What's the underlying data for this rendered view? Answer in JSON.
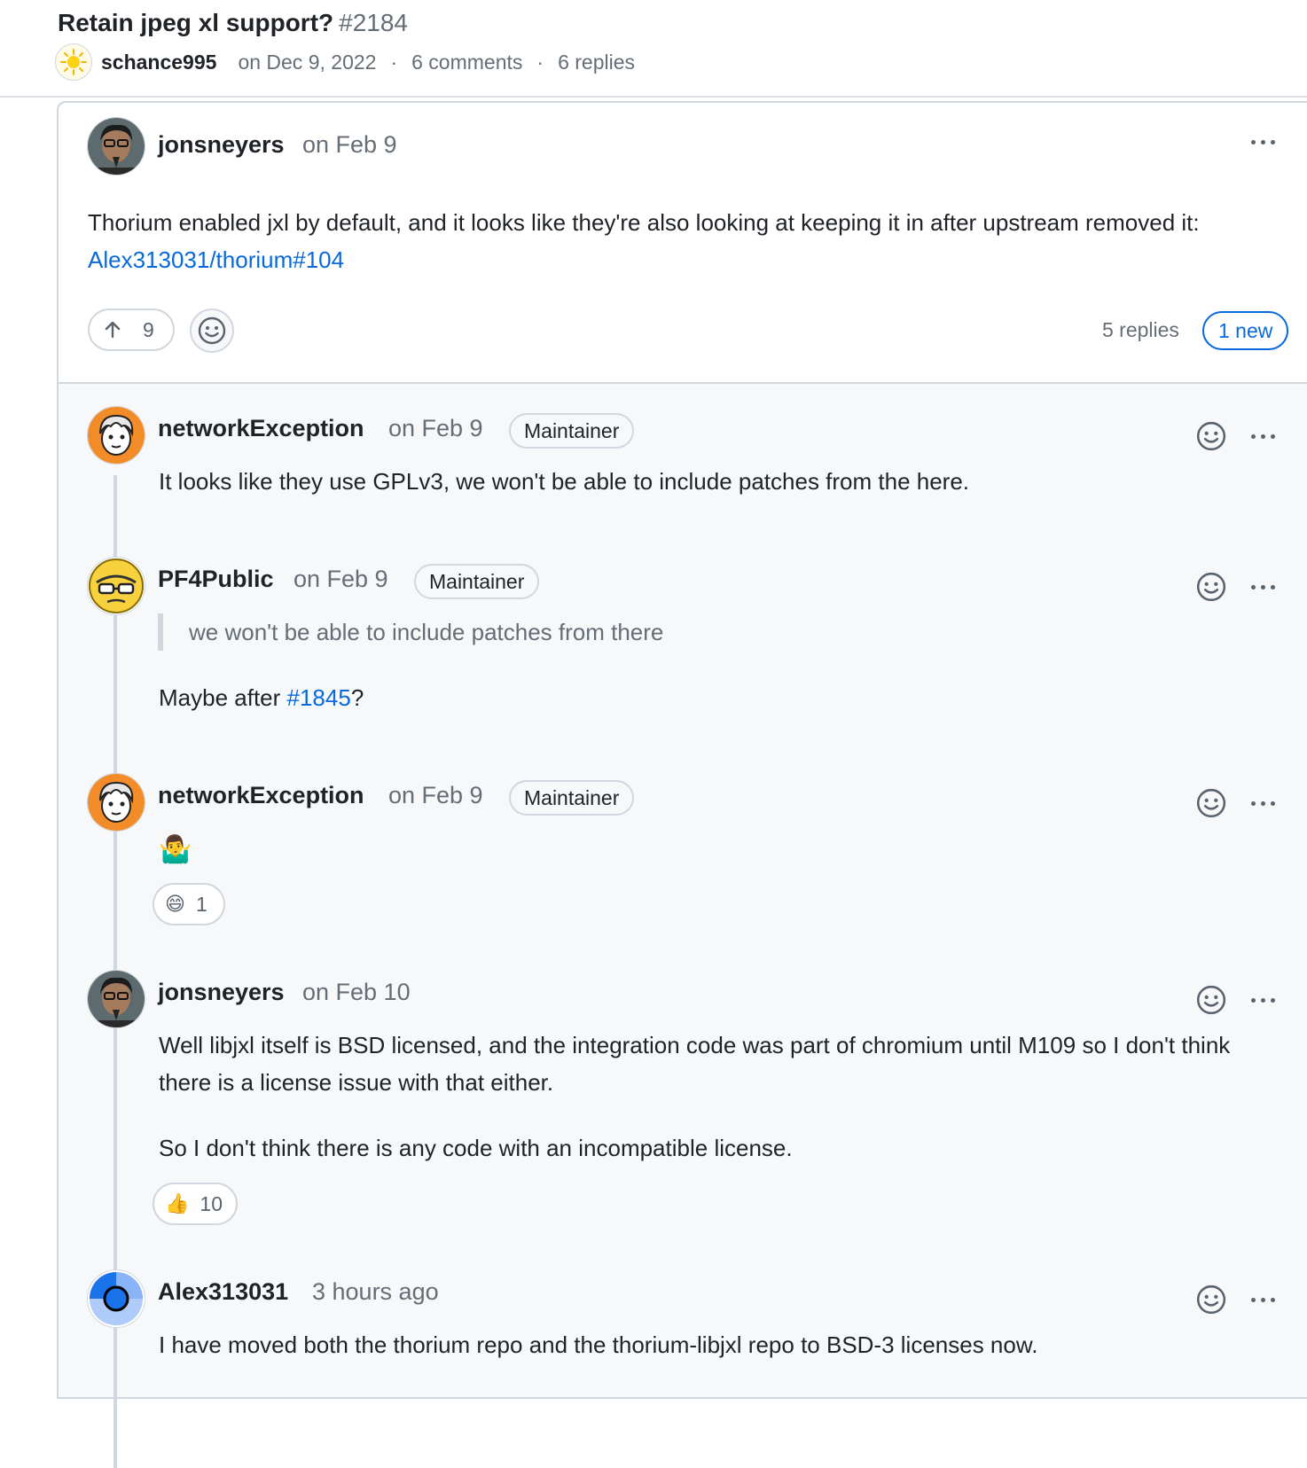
{
  "discussion": {
    "title": "Retain jpeg xl support?",
    "number": "#2184",
    "author": "schance995",
    "date": "on Dec 9, 2022",
    "comments_count": "6 comments",
    "replies_count": "6 replies",
    "separator": "·"
  },
  "top_comment": {
    "author": "jonsneyers",
    "date": "on Feb 9",
    "body_text": "Thorium enabled jxl by default, and it looks like they're also looking at keeping it in after upstream removed it: ",
    "body_link": "Alex313031/thorium#104",
    "upvotes": "9",
    "replies": "5 replies",
    "new_label": "1 new"
  },
  "replies": [
    {
      "author": "networkException",
      "date": "on Feb 9",
      "badge": "Maintainer",
      "body": "It looks like they use GPLv3, we won't be able to include patches from the here."
    },
    {
      "author": "PF4Public",
      "date": "on Feb 9",
      "badge": "Maintainer",
      "quote": "we won't be able to include patches from there",
      "body_prefix": "Maybe after ",
      "body_link": "#1845",
      "body_suffix": "?"
    },
    {
      "author": "networkException",
      "date": "on Feb 9",
      "badge": "Maintainer",
      "body": "🤷‍♂️",
      "reaction_emoji": "😄",
      "reaction_count": "1"
    },
    {
      "author": "jonsneyers",
      "date": "on Feb 10",
      "body_p1": "Well libjxl itself is BSD licensed, and the integration code was part of chromium until M109 so I don't think there is a license issue with that either.",
      "body_p2": "So I don't think there is any code with an incompatible license.",
      "reaction_emoji": "👍",
      "reaction_count": "10"
    },
    {
      "author": "Alex313031",
      "date": "3 hours ago",
      "body": "I have moved both the thorium repo and the thorium-libjxl repo to BSD-3 licenses now."
    }
  ],
  "icons": {
    "author_avatar": "sun-avatar-icon",
    "kebab": "kebab-horizontal-icon",
    "smiley": "smiley-icon",
    "upvote": "arrow-up-icon"
  },
  "colors": {
    "link": "#0969da",
    "muted": "#656d76",
    "border": "#d0d7de"
  }
}
